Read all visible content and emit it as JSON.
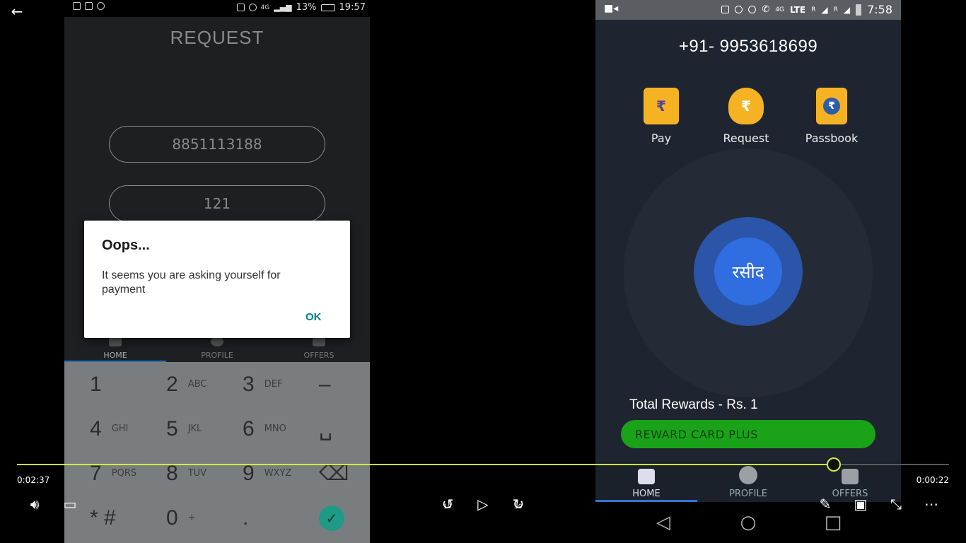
{
  "left_phone": {
    "status_bar": {
      "battery": "13%",
      "time": "19:57",
      "network": "4G"
    },
    "title": "REQUEST",
    "phone_field": {
      "value": "8851113188"
    },
    "amount_field": {
      "value": "121"
    },
    "tabs": [
      {
        "label": "HOME",
        "icon": "home-icon",
        "active": true
      },
      {
        "label": "PROFILE",
        "icon": "profile-icon"
      },
      {
        "label": "OFFERS",
        "icon": "tag-icon"
      }
    ],
    "keypad": [
      {
        "digit": "1",
        "letters": ""
      },
      {
        "digit": "2",
        "letters": "ABC"
      },
      {
        "digit": "3",
        "letters": "DEF"
      },
      {
        "digit": "–",
        "letters": ""
      },
      {
        "digit": "4",
        "letters": "GHI"
      },
      {
        "digit": "5",
        "letters": "JKL"
      },
      {
        "digit": "6",
        "letters": "MNO"
      },
      {
        "digit": "␣",
        "letters": ""
      },
      {
        "digit": "7",
        "letters": "PQRS"
      },
      {
        "digit": "8",
        "letters": "TUV"
      },
      {
        "digit": "9",
        "letters": "WXYZ"
      },
      {
        "digit": "⌫",
        "letters": ""
      },
      {
        "digit": "* #",
        "letters": ""
      },
      {
        "digit": "0",
        "letters": "+"
      },
      {
        "digit": ".",
        "letters": ""
      },
      {
        "digit": "✓",
        "letters": ""
      }
    ],
    "dialog": {
      "title": "Oops...",
      "message": "It seems you are asking yourself for payment",
      "ok_label": "OK"
    }
  },
  "right_phone": {
    "status_bar": {
      "time": "7:58",
      "network": "LTE",
      "network_4g": "4G",
      "roaming_1": "R",
      "roaming_2": "R"
    },
    "phone_number": "+91- 9953618699",
    "actions": [
      {
        "label": "Pay",
        "icon": "pay-icon",
        "symbol": "₹"
      },
      {
        "label": "Request",
        "icon": "request-money-bag-icon",
        "symbol": "₹"
      },
      {
        "label": "Passbook",
        "icon": "passbook-icon",
        "symbol": "₹"
      }
    ],
    "receipt_button": "रसीद",
    "total_rewards": "Total Rewards - Rs. 1",
    "reward_card_button": "REWARD CARD PLUS",
    "tabs": [
      {
        "label": "HOME",
        "icon": "home-icon",
        "active": true
      },
      {
        "label": "PROFILE",
        "icon": "profile-icon"
      },
      {
        "label": "OFFERS",
        "icon": "tag-icon"
      }
    ]
  },
  "player": {
    "elapsed": "0:02:37",
    "remaining": "0:00:22",
    "progress_fraction": 0.876,
    "rewind_seconds": "10",
    "forward_seconds": "30",
    "accent_color": "#c8f23c"
  }
}
